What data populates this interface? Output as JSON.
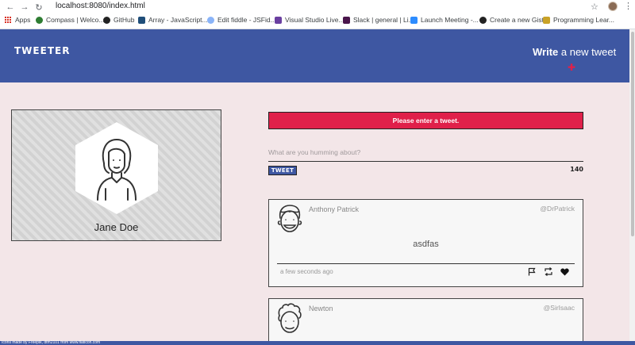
{
  "browser": {
    "url": "localhost:8080/index.html",
    "bookmarks": [
      {
        "label": "Apps"
      },
      {
        "label": "Compass | Welco..."
      },
      {
        "label": "GitHub"
      },
      {
        "label": "Array - JavaScript..."
      },
      {
        "label": "Edit fiddle - JSFid..."
      },
      {
        "label": "Visual Studio Live..."
      },
      {
        "label": "Slack | general | Li..."
      },
      {
        "label": "Launch Meeting -..."
      },
      {
        "label": "Create a new Gist"
      },
      {
        "label": "Programming Lear..."
      }
    ]
  },
  "header": {
    "logo": "TWEETER",
    "compose_bold": "Write",
    "compose_rest": " a new tweet"
  },
  "profile": {
    "name": "Jane Doe"
  },
  "composer": {
    "error": "Please enter a tweet.",
    "placeholder": "What are you humming about?",
    "button": "TWEET",
    "counter": "140"
  },
  "tweets": [
    {
      "name": "Anthony Patrick",
      "handle": "@DrPatrick",
      "body": "asdfas",
      "time": "a few seconds ago"
    },
    {
      "name": "Newton",
      "handle": "@SirIsaac"
    }
  ],
  "footer": {
    "credit": "Icons made by Freepik, dtm2101 from www.flaticon.com"
  },
  "colors": {
    "header_blue": "#3e57a2",
    "error_red": "#e0204a",
    "page_bg": "#f3e6e8"
  }
}
